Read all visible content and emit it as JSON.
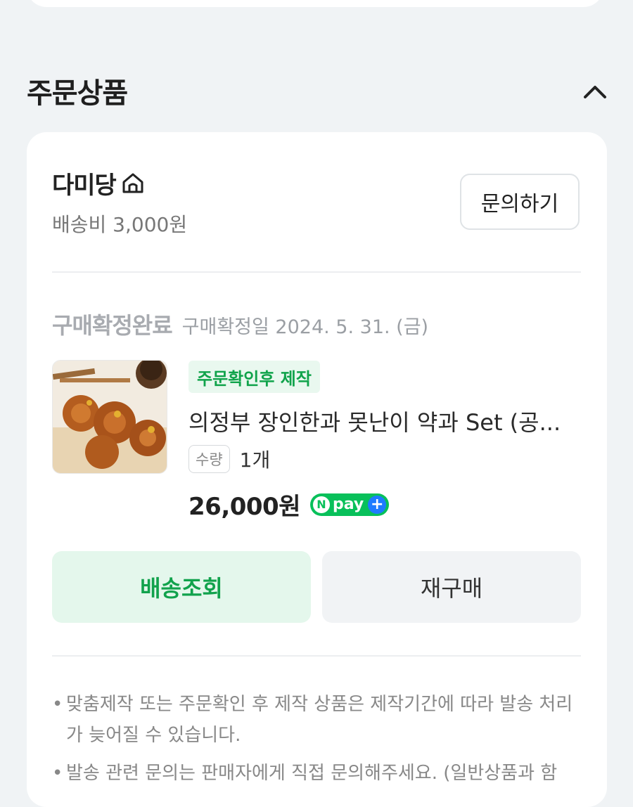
{
  "section": {
    "title": "주문상품"
  },
  "store": {
    "name": "다미당",
    "shipping_fee": "배송비 3,000원",
    "inquiry_button": "문의하기"
  },
  "order": {
    "status": "구매확정완료",
    "confirm_date": "구매확정일 2024. 5. 31. (금)"
  },
  "product": {
    "badge": "주문확인후 제작",
    "name": "의정부 장인한과 못난이 약과 Set (공...",
    "quantity_label": "수량",
    "quantity_value": "1개",
    "price": "26,000원",
    "npay_label": "pay"
  },
  "actions": {
    "track_button": "배송조회",
    "rebuy_button": "재구매"
  },
  "notices": [
    {
      "bullet": "•",
      "text": "맞춤제작 또는 주문확인 후 제작 상품은 제작기간에 따라 발송 처리가 늦어질 수 있습니다."
    },
    {
      "bullet": "•",
      "text": "발송 관련 문의는 판매자에게 직접 문의해주세요. (일반상품과 함"
    }
  ],
  "colors": {
    "accent_green": "#11a24c",
    "badge_bg": "#e9f8ef",
    "npay_green": "#08c05a",
    "npay_blue": "#1e7bff",
    "page_bg": "#f0f3f5"
  }
}
